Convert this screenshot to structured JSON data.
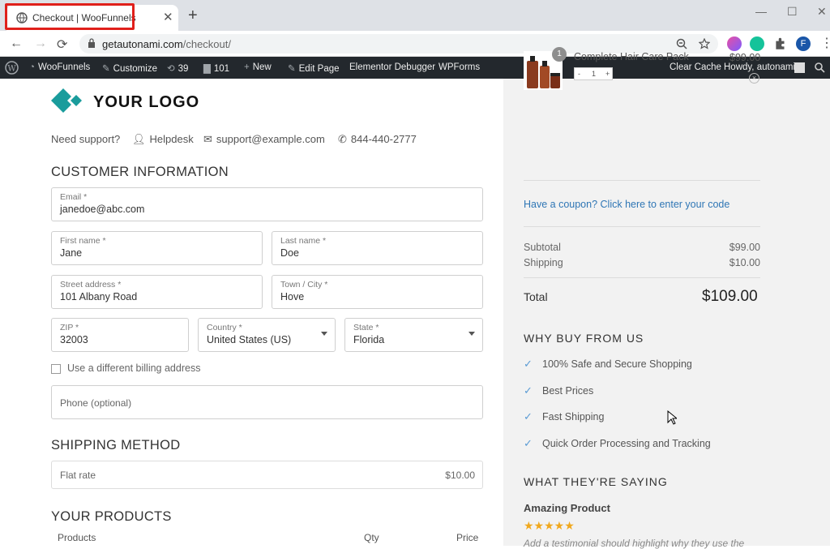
{
  "browser": {
    "tab_title": "Checkout | WooFunnels",
    "tab_close": "✕",
    "new_tab": "+",
    "url_host": "getautonami.com",
    "url_path": "/checkout/",
    "back": "←",
    "forward": "→",
    "reload": "⟳",
    "window_controls": [
      "—",
      "☐",
      "✕"
    ],
    "profile_initial": "F"
  },
  "wpbar": {
    "items": [
      {
        "label": "WooFunnels",
        "icon": "gauge-icon"
      },
      {
        "label": "Customize",
        "icon": "brush-icon"
      },
      {
        "label": "39",
        "icon": "updates-icon"
      },
      {
        "label": "101",
        "icon": "comments-icon"
      },
      {
        "label": "New",
        "icon": "plus-icon"
      },
      {
        "label": "Edit Page",
        "icon": "pencil-icon"
      },
      {
        "label": "Elementor Debugger",
        "icon": ""
      },
      {
        "label": "WPForms",
        "icon": ""
      }
    ],
    "clear_cache": "Clear Cache",
    "howdy": "Howdy, autonami"
  },
  "logo_text": "YOUR LOGO",
  "support": {
    "prompt": "Need support?",
    "helpdesk": "Helpdesk",
    "email": "support@example.com",
    "phone": "844-440-2777"
  },
  "customer_info": {
    "title": "CUSTOMER INFORMATION",
    "email": {
      "label": "Email *",
      "value": "janedoe@abc.com"
    },
    "first_name": {
      "label": "First name *",
      "value": "Jane"
    },
    "last_name": {
      "label": "Last name *",
      "value": "Doe"
    },
    "street": {
      "label": "Street address *",
      "value": "101 Albany Road"
    },
    "city": {
      "label": "Town / City *",
      "value": "Hove"
    },
    "zip": {
      "label": "ZIP *",
      "value": "32003"
    },
    "country": {
      "label": "Country *",
      "value": "United States (US)"
    },
    "state": {
      "label": "State *",
      "value": "Florida"
    },
    "billing_label": "Use a different billing address",
    "phone_placeholder": "Phone (optional)"
  },
  "shipping": {
    "title": "SHIPPING METHOD",
    "method": "Flat rate",
    "price": "$10.00"
  },
  "products": {
    "title": "YOUR PRODUCTS",
    "col_products": "Products",
    "col_qty": "Qty",
    "col_price": "Price"
  },
  "cart": {
    "badge": "1",
    "product_name": "Complete Hair Care Pack",
    "product_price": "$99.00",
    "qty_minus": "-",
    "qty_value": "1",
    "qty_plus": "+",
    "remove": "×",
    "coupon": "Have a coupon? Click here to enter your code",
    "subtotal_label": "Subtotal",
    "subtotal_value": "$99.00",
    "shipping_label": "Shipping",
    "shipping_value": "$10.00",
    "total_label": "Total",
    "total_value": "$109.00"
  },
  "why_buy": {
    "title": "WHY BUY FROM US",
    "items": [
      "100% Safe and Secure Shopping",
      "Best Prices",
      "Fast Shipping",
      "Quick Order Processing and Tracking"
    ]
  },
  "testimonials": {
    "title": "WHAT THEY'RE SAYING",
    "review_title": "Amazing Product",
    "stars": "★★★★★",
    "review_text": "Add a testimonial should highlight why they use the"
  },
  "colors": {
    "accent": "#2f76b5",
    "highlight": "#e0201b",
    "logo": "#1a9c9c",
    "wpbar": "#23282d"
  }
}
